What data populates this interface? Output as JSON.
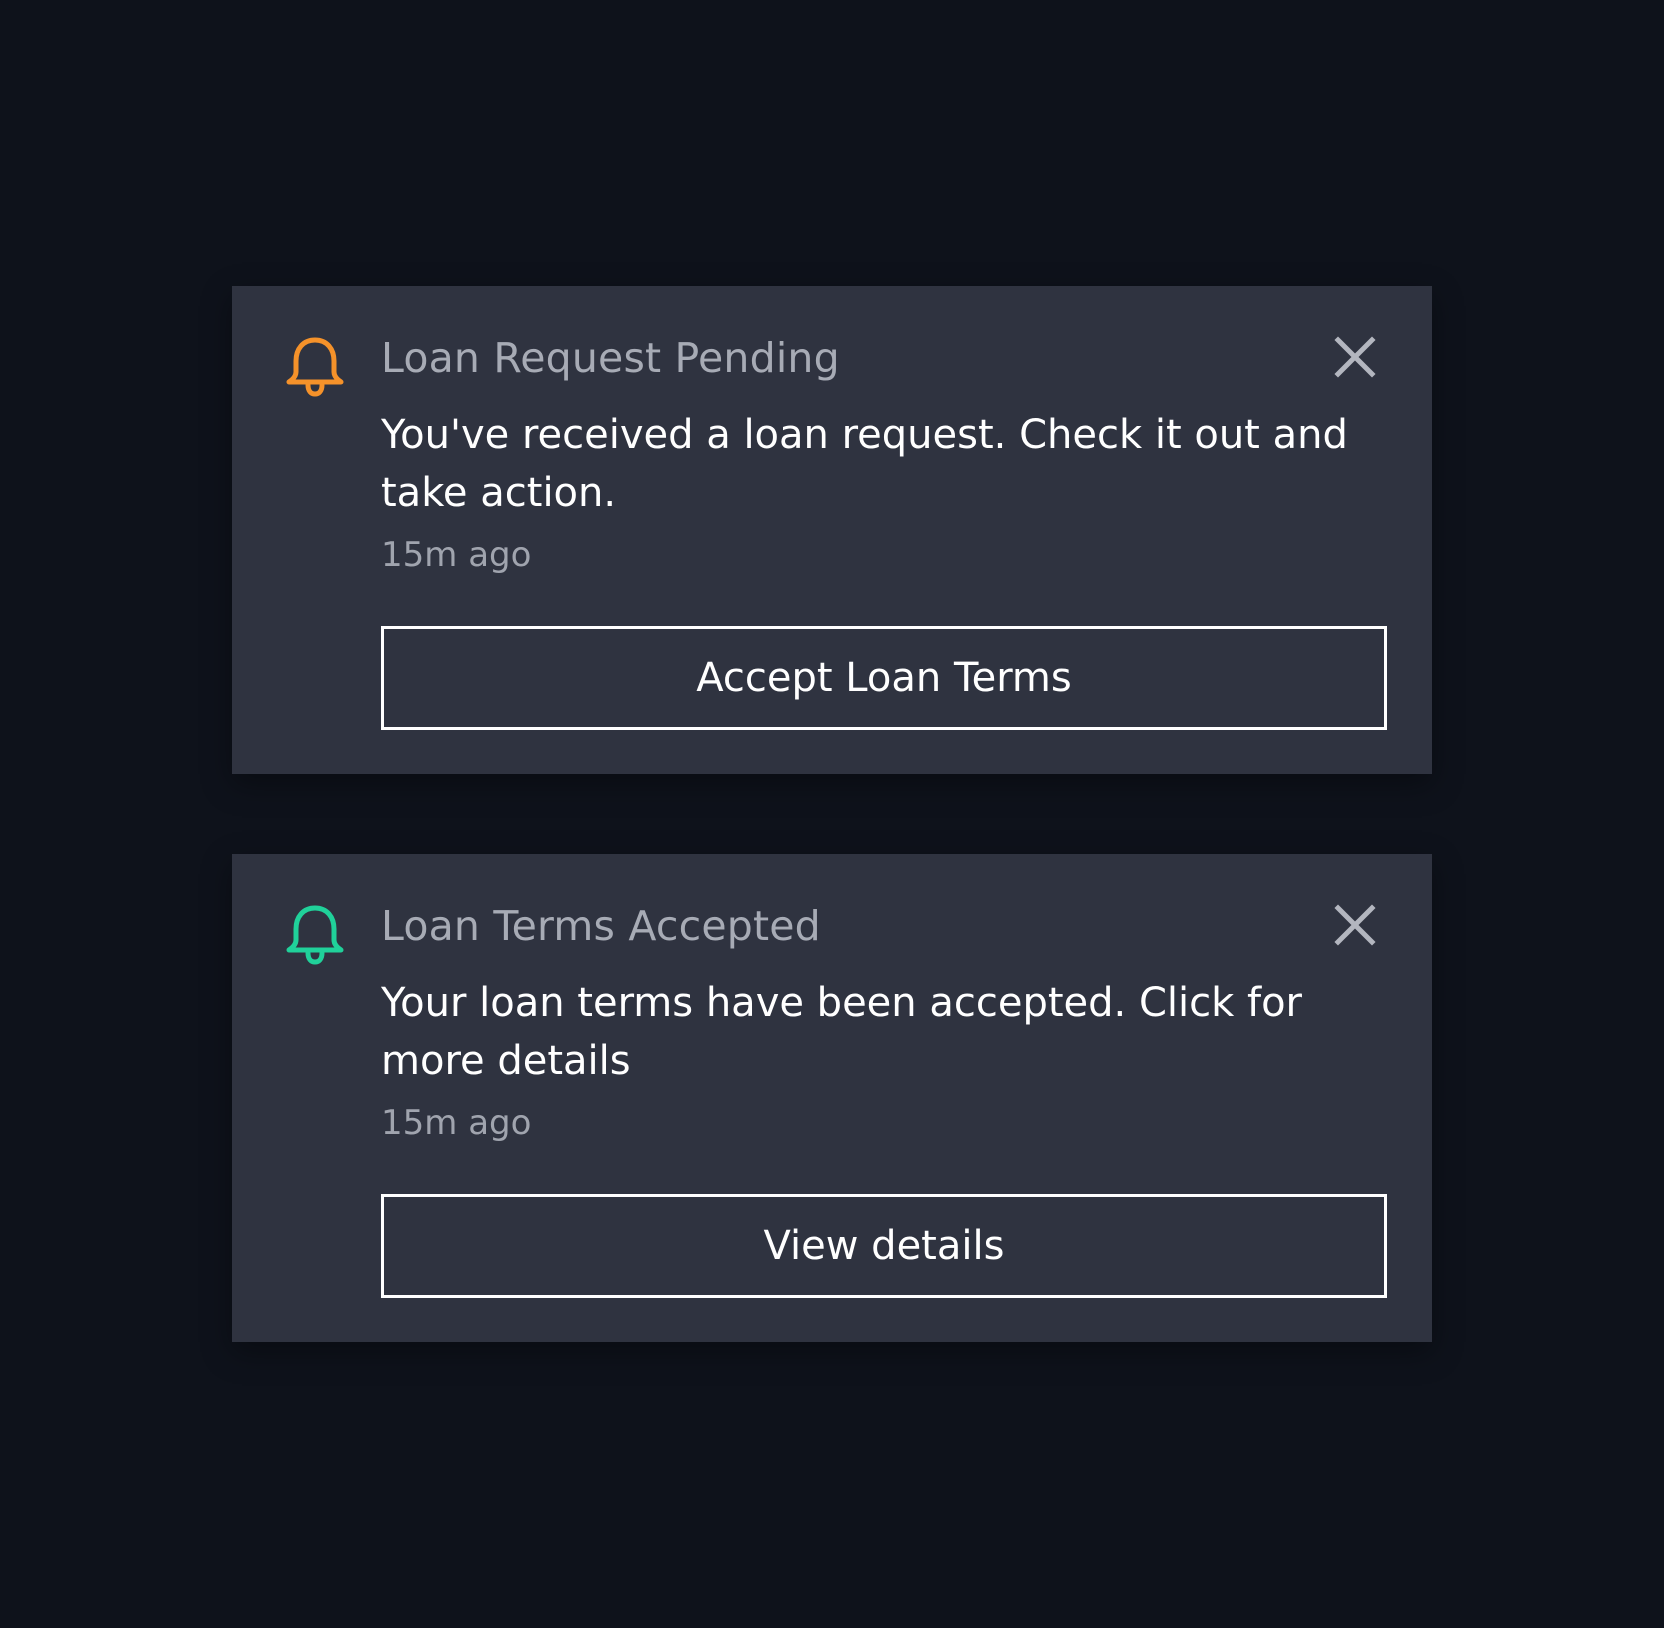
{
  "colors": {
    "background": "#0e121b",
    "card": "#2f3340",
    "pending_accent": "#f5922a",
    "accepted_accent": "#20d19a",
    "title_text": "#a7abb5",
    "body_text": "#ffffff"
  },
  "notifications": [
    {
      "icon": "bell-icon",
      "icon_color": "#f5922a",
      "title": "Loan Request Pending",
      "message": "You've received a loan request. Check it out and take action.",
      "time": "15m ago",
      "action_label": "Accept Loan Terms",
      "close_icon": "close-icon"
    },
    {
      "icon": "bell-icon",
      "icon_color": "#20d19a",
      "title": "Loan Terms Accepted",
      "message": "Your loan terms have been accepted. Click for more details",
      "time": "15m ago",
      "action_label": "View details",
      "close_icon": "close-icon"
    }
  ]
}
